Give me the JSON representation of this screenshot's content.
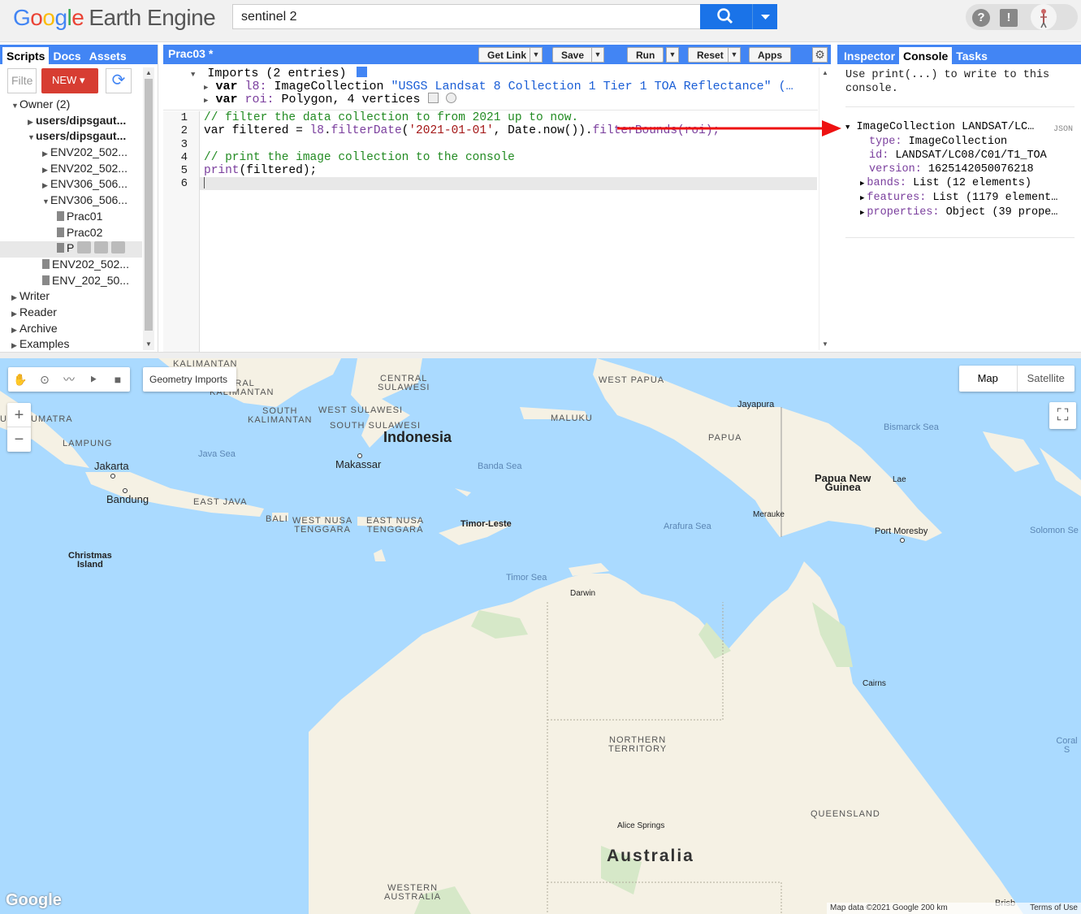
{
  "app": {
    "logo_google": [
      "G",
      "o",
      "o",
      "g",
      "l",
      "e"
    ],
    "logo_product": "Earth Engine"
  },
  "search": {
    "value": "sentinel 2"
  },
  "top_icons": {
    "help": "?",
    "feedback": "!"
  },
  "left_panel": {
    "tabs": [
      "Scripts",
      "Docs",
      "Assets"
    ],
    "active_tab": "Scripts",
    "filter_placeholder": "Filte",
    "new_button": "NEW",
    "tree": [
      {
        "label": "Owner (2)",
        "level": 0,
        "caret": "▼",
        "icon": "",
        "bold": false
      },
      {
        "label": "users/dipsgaut...",
        "level": 1,
        "caret": "▶",
        "icon": "",
        "bold": true
      },
      {
        "label": "users/dipsgaut...",
        "level": 1,
        "caret": "▼",
        "icon": "",
        "bold": true
      },
      {
        "label": "ENV202_502...",
        "level": 2,
        "caret": "▶",
        "icon": "",
        "bold": false
      },
      {
        "label": "ENV202_502...",
        "level": 2,
        "caret": "▶",
        "icon": "",
        "bold": false
      },
      {
        "label": "ENV306_506...",
        "level": 2,
        "caret": "▶",
        "icon": "",
        "bold": false
      },
      {
        "label": "ENV306_506...",
        "level": 2,
        "caret": "▼",
        "icon": "",
        "bold": false
      },
      {
        "label": "Prac01",
        "level": 3,
        "caret": "",
        "icon": "file",
        "bold": false
      },
      {
        "label": "Prac02",
        "level": 3,
        "caret": "",
        "icon": "file",
        "bold": false
      },
      {
        "label": "P",
        "level": 3,
        "caret": "",
        "icon": "file",
        "bold": false,
        "selected": true
      },
      {
        "label": "ENV202_502...",
        "level": 2,
        "caret": "",
        "icon": "file",
        "bold": false
      },
      {
        "label": "ENV_202_50...",
        "level": 2,
        "caret": "",
        "icon": "file",
        "bold": false
      },
      {
        "label": "Writer",
        "level": 0,
        "caret": "▶",
        "icon": "",
        "bold": false
      },
      {
        "label": "Reader",
        "level": 0,
        "caret": "▶",
        "icon": "",
        "bold": false
      },
      {
        "label": "Archive",
        "level": 0,
        "caret": "▶",
        "icon": "",
        "bold": false
      },
      {
        "label": "Examples",
        "level": 0,
        "caret": "▶",
        "icon": "",
        "bold": false
      }
    ]
  },
  "editor": {
    "title": "Prac03 *",
    "buttons": {
      "get_link": "Get Link",
      "save": "Save",
      "run": "Run",
      "reset": "Reset",
      "apps": "Apps"
    },
    "imports_header": "Imports (2 entries)",
    "imports": [
      {
        "kw": "var",
        "name": "l8:",
        "type": "ImageCollection",
        "detail": "\"USGS Landsat 8 Collection 1 Tier 1 TOA Reflectance\" (…"
      },
      {
        "kw": "var",
        "name": "roi:",
        "type": "Polygon, 4 vertices",
        "detail": ""
      }
    ],
    "line_numbers": [
      "1",
      "2",
      "3",
      "4",
      "5",
      "6"
    ],
    "code": {
      "l1": "// filter the data collection to from 2021 up to now.",
      "l2_a": "var filtered = ",
      "l2_b": "l8",
      "l2_c": ".",
      "l2_d": "filterDate",
      "l2_e": "(",
      "l2_f": "'2021-01-01'",
      "l2_g": ", Date.now()).",
      "l2_h": "filterBounds",
      "l2_i": "(roi);",
      "l4": "// print the image collection to the console",
      "l5_a": "print",
      "l5_b": "(filtered);"
    }
  },
  "right_panel": {
    "tabs": [
      "Inspector",
      "Console",
      "Tasks"
    ],
    "active_tab": "Console",
    "hint": "Use print(...) to write to this console.",
    "object_header": "ImageCollection LANDSAT/LC…",
    "json_tag": "JSON",
    "fields": [
      {
        "key": "type:",
        "value": "ImageCollection",
        "caret": ""
      },
      {
        "key": "id:",
        "value": "LANDSAT/LC08/C01/T1_TOA",
        "caret": ""
      },
      {
        "key": "version:",
        "value": "1625142050076218",
        "caret": ""
      },
      {
        "key": "bands:",
        "value": "List (12 elements)",
        "caret": "▶"
      },
      {
        "key": "features:",
        "value": "List (1179 element…",
        "caret": "▶"
      },
      {
        "key": "properties:",
        "value": "Object (39 prope…",
        "caret": "▶"
      }
    ]
  },
  "map": {
    "geometry_imports": "Geometry Imports",
    "map_type": [
      "Map",
      "Satellite"
    ],
    "attribution": "Map data ©2021 Google   200 km",
    "terms": "Terms of Use",
    "logo": "Google",
    "labels": {
      "kalimantan": "KALIMANTAN",
      "central_kalimantan": "TRAL\nKALIMANTAN",
      "south_kalimantan": "SOUTH\nKALIMANTAN",
      "central_sulawesi": "CENTRAL\nSULAWESI",
      "west_sulawesi": "WEST SULAWESI",
      "south_sulawesi": "SOUTH SULAWESI",
      "west_papua": "WEST PAPUA",
      "maluku": "MALUKU",
      "papua": "PAPUA",
      "jayapura": "Jayapura",
      "bismarck_sea": "Bismarck Sea",
      "south_sumatra": "UTH SUMATRA",
      "lampung": "LAMPUNG",
      "indonesia": "Indonesia",
      "makassar": "Makassar",
      "java_sea": "Java Sea",
      "banda_sea": "Banda Sea",
      "jakarta": "Jakarta",
      "bandung": "Bandung",
      "east_java": "EAST JAVA",
      "bali": "BALI",
      "west_nusa": "WEST NUSA\nTENGGARA",
      "east_nusa": "EAST NUSA\nTENGGARA",
      "timor_leste": "Timor-Leste",
      "png": "Papua New\nGuinea",
      "lae": "Lae",
      "merauke": "Merauke",
      "arafura_sea": "Arafura Sea",
      "port_moresby": "Port Moresby",
      "solomon_sea": "Solomon Se",
      "christmas_island": "Christmas\nIsland",
      "timor_sea": "Timor Sea",
      "darwin": "Darwin",
      "cairns": "Cairns",
      "northern_territory": "NORTHERN\nTERRITORY",
      "coral_sea": "Coral S",
      "queensland": "QUEENSLAND",
      "alice_springs": "Alice Springs",
      "australia": "Australia",
      "western_australia": "WESTERN\nAUSTRALIA",
      "brisbane": "Brisb"
    }
  },
  "colors": {
    "tab_blue": "#4285f4",
    "new_red": "#d73d32",
    "arrow_red": "#ee1111",
    "sea": "#aadaff",
    "land": "#f5f1e4"
  }
}
